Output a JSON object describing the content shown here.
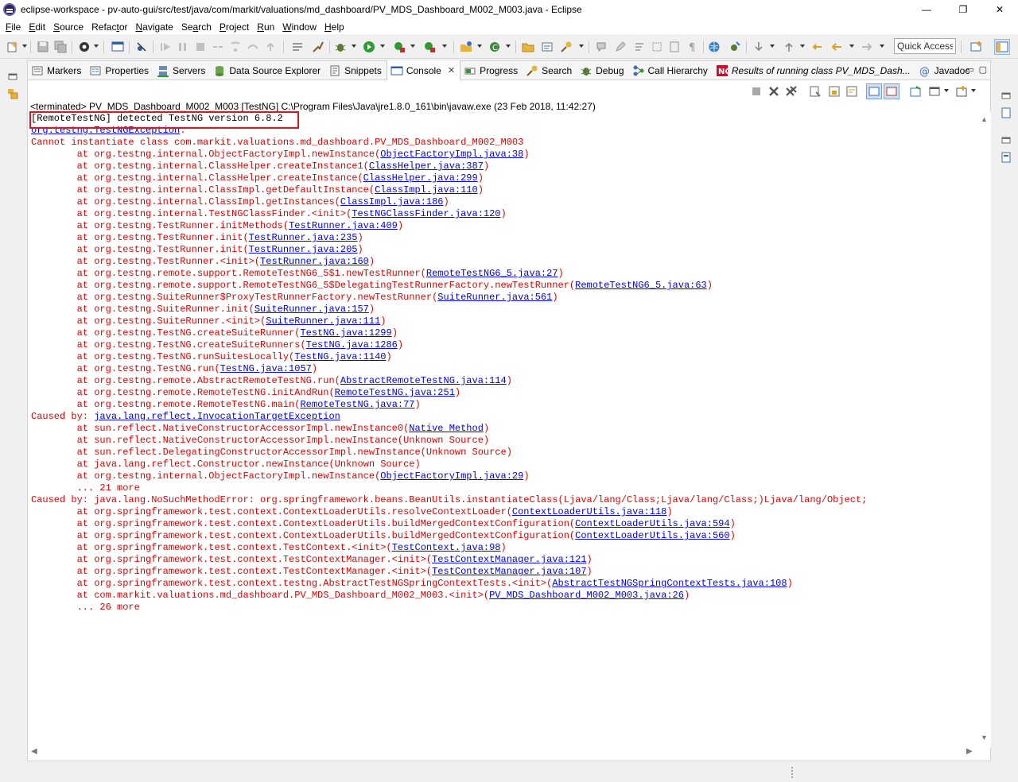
{
  "window": {
    "title": "eclipse-workspace - pv-auto-gui/src/test/java/com/markit/valuations/md_dashboard/PV_MDS_Dashboard_M002_M003.java - Eclipse",
    "minimize": "—",
    "maximize": "❐",
    "close": "✕"
  },
  "menu": [
    {
      "m": "F",
      "rest": "ile"
    },
    {
      "m": "E",
      "rest": "dit"
    },
    {
      "m": "S",
      "rest": "ource"
    },
    {
      "m": "",
      "pre": "Refac",
      "m2": "t",
      "rest": "or"
    },
    {
      "m": "N",
      "rest": "avigate"
    },
    {
      "m": "",
      "pre": "Se",
      "m2": "a",
      "rest": "rch"
    },
    {
      "m": "P",
      "rest": "roject"
    },
    {
      "m": "R",
      "rest": "un"
    },
    {
      "m": "W",
      "rest": "indow"
    },
    {
      "m": "H",
      "rest": "elp"
    }
  ],
  "quick_access": "Quick Access",
  "tabs": [
    {
      "label": "Markers",
      "icon": "markers-icon"
    },
    {
      "label": "Properties",
      "icon": "properties-icon"
    },
    {
      "label": "Servers",
      "icon": "servers-icon"
    },
    {
      "label": "Data Source Explorer",
      "icon": "data-source-icon"
    },
    {
      "label": "Snippets",
      "icon": "snippets-icon"
    },
    {
      "label": "Console",
      "icon": "console-icon",
      "active": true,
      "close": "✕"
    },
    {
      "label": "Progress",
      "icon": "progress-icon"
    },
    {
      "label": "Search",
      "icon": "search-icon"
    },
    {
      "label": "Debug",
      "icon": "debug-icon"
    },
    {
      "label": "Call Hierarchy",
      "icon": "call-hierarchy-icon"
    },
    {
      "label": "Results of running class PV_MDS_Dash...",
      "icon": "testng-icon",
      "italic": true
    },
    {
      "label": "Javadoc",
      "icon": "javadoc-icon"
    }
  ],
  "view_controls": {
    "minimize": "▭",
    "maximize": "▢"
  },
  "console": {
    "header": "<terminated> PV_MDS_Dashboard_M002_M003 [TestNG] C:\\Program Files\\Java\\jre1.8.0_161\\bin\\javaw.exe (23 Feb 2018, 11:42:27)",
    "lines": [
      {
        "type": "info",
        "parts": [
          {
            "t": "[RemoteTestNG] detected TestNG version 6.8.2"
          }
        ]
      },
      {
        "type": "link-only",
        "parts": [
          {
            "t": "org.testng.TestNGException",
            "link": true
          },
          {
            "t": ":"
          }
        ]
      },
      {
        "parts": [
          {
            "t": "Cannot instantiate class com.markit.valuations.md_dashboard.PV_MDS_Dashboard_M002_M003"
          }
        ]
      },
      {
        "parts": [
          {
            "t": "\tat org.testng.internal.ObjectFactoryImpl.newInstance("
          },
          {
            "t": "ObjectFactoryImpl.java:38",
            "link": true
          },
          {
            "t": ")"
          }
        ]
      },
      {
        "parts": [
          {
            "t": "\tat org.testng.internal.ClassHelper.createInstance1("
          },
          {
            "t": "ClassHelper.java:387",
            "link": true
          },
          {
            "t": ")"
          }
        ]
      },
      {
        "parts": [
          {
            "t": "\tat org.testng.internal.ClassHelper.createInstance("
          },
          {
            "t": "ClassHelper.java:299",
            "link": true
          },
          {
            "t": ")"
          }
        ]
      },
      {
        "parts": [
          {
            "t": "\tat org.testng.internal.ClassImpl.getDefaultInstance("
          },
          {
            "t": "ClassImpl.java:110",
            "link": true
          },
          {
            "t": ")"
          }
        ]
      },
      {
        "parts": [
          {
            "t": "\tat org.testng.internal.ClassImpl.getInstances("
          },
          {
            "t": "ClassImpl.java:186",
            "link": true
          },
          {
            "t": ")"
          }
        ]
      },
      {
        "parts": [
          {
            "t": "\tat org.testng.internal.TestNGClassFinder.<init>("
          },
          {
            "t": "TestNGClassFinder.java:120",
            "link": true
          },
          {
            "t": ")"
          }
        ]
      },
      {
        "parts": [
          {
            "t": "\tat org.testng.TestRunner.initMethods("
          },
          {
            "t": "TestRunner.java:409",
            "link": true
          },
          {
            "t": ")"
          }
        ]
      },
      {
        "parts": [
          {
            "t": "\tat org.testng.TestRunner.init("
          },
          {
            "t": "TestRunner.java:235",
            "link": true
          },
          {
            "t": ")"
          }
        ]
      },
      {
        "parts": [
          {
            "t": "\tat org.testng.TestRunner.init("
          },
          {
            "t": "TestRunner.java:205",
            "link": true
          },
          {
            "t": ")"
          }
        ]
      },
      {
        "parts": [
          {
            "t": "\tat org.testng.TestRunner.<init>("
          },
          {
            "t": "TestRunner.java:160",
            "link": true
          },
          {
            "t": ")"
          }
        ]
      },
      {
        "parts": [
          {
            "t": "\tat org.testng.remote.support.RemoteTestNG6_5$1.newTestRunner("
          },
          {
            "t": "RemoteTestNG6_5.java:27",
            "link": true
          },
          {
            "t": ")"
          }
        ]
      },
      {
        "parts": [
          {
            "t": "\tat org.testng.remote.support.RemoteTestNG6_5$DelegatingTestRunnerFactory.newTestRunner("
          },
          {
            "t": "RemoteTestNG6_5.java:63",
            "link": true
          },
          {
            "t": ")"
          }
        ]
      },
      {
        "parts": [
          {
            "t": "\tat org.testng.SuiteRunner$ProxyTestRunnerFactory.newTestRunner("
          },
          {
            "t": "SuiteRunner.java:561",
            "link": true
          },
          {
            "t": ")"
          }
        ]
      },
      {
        "parts": [
          {
            "t": "\tat org.testng.SuiteRunner.init("
          },
          {
            "t": "SuiteRunner.java:157",
            "link": true
          },
          {
            "t": ")"
          }
        ]
      },
      {
        "parts": [
          {
            "t": "\tat org.testng.SuiteRunner.<init>("
          },
          {
            "t": "SuiteRunner.java:111",
            "link": true
          },
          {
            "t": ")"
          }
        ]
      },
      {
        "parts": [
          {
            "t": "\tat org.testng.TestNG.createSuiteRunner("
          },
          {
            "t": "TestNG.java:1299",
            "link": true
          },
          {
            "t": ")"
          }
        ]
      },
      {
        "parts": [
          {
            "t": "\tat org.testng.TestNG.createSuiteRunners("
          },
          {
            "t": "TestNG.java:1286",
            "link": true
          },
          {
            "t": ")"
          }
        ]
      },
      {
        "parts": [
          {
            "t": "\tat org.testng.TestNG.runSuitesLocally("
          },
          {
            "t": "TestNG.java:1140",
            "link": true
          },
          {
            "t": ")"
          }
        ]
      },
      {
        "parts": [
          {
            "t": "\tat org.testng.TestNG.run("
          },
          {
            "t": "TestNG.java:1057",
            "link": true
          },
          {
            "t": ")"
          }
        ]
      },
      {
        "parts": [
          {
            "t": "\tat org.testng.remote.AbstractRemoteTestNG.run("
          },
          {
            "t": "AbstractRemoteTestNG.java:114",
            "link": true
          },
          {
            "t": ")"
          }
        ]
      },
      {
        "parts": [
          {
            "t": "\tat org.testng.remote.RemoteTestNG.initAndRun("
          },
          {
            "t": "RemoteTestNG.java:251",
            "link": true
          },
          {
            "t": ")"
          }
        ]
      },
      {
        "parts": [
          {
            "t": "\tat org.testng.remote.RemoteTestNG.main("
          },
          {
            "t": "RemoteTestNG.java:77",
            "link": true
          },
          {
            "t": ")"
          }
        ]
      },
      {
        "parts": [
          {
            "t": "Caused by: "
          },
          {
            "t": "java.lang.reflect.InvocationTargetException",
            "link": true
          }
        ]
      },
      {
        "parts": [
          {
            "t": "\tat sun.reflect.NativeConstructorAccessorImpl.newInstance0("
          },
          {
            "t": "Native Method",
            "link": true
          },
          {
            "t": ")"
          }
        ]
      },
      {
        "parts": [
          {
            "t": "\tat sun.reflect.NativeConstructorAccessorImpl.newInstance(Unknown Source)"
          }
        ]
      },
      {
        "parts": [
          {
            "t": "\tat sun.reflect.DelegatingConstructorAccessorImpl.newInstance(Unknown Source)"
          }
        ]
      },
      {
        "parts": [
          {
            "t": "\tat java.lang.reflect.Constructor.newInstance(Unknown Source)"
          }
        ]
      },
      {
        "parts": [
          {
            "t": "\tat org.testng.internal.ObjectFactoryImpl.newInstance("
          },
          {
            "t": "ObjectFactoryImpl.java:29",
            "link": true
          },
          {
            "t": ")"
          }
        ]
      },
      {
        "parts": [
          {
            "t": "\t... 21 more"
          }
        ]
      },
      {
        "parts": [
          {
            "t": "Caused by: java.lang.NoSuchMethodError: org.springframework.beans.BeanUtils.instantiateClass(Ljava/lang/Class;Ljava/lang/Class;)Ljava/lang/Object;"
          }
        ]
      },
      {
        "parts": [
          {
            "t": "\tat org.springframework.test.context.ContextLoaderUtils.resolveContextLoader("
          },
          {
            "t": "ContextLoaderUtils.java:118",
            "link": true
          },
          {
            "t": ")"
          }
        ]
      },
      {
        "parts": [
          {
            "t": "\tat org.springframework.test.context.ContextLoaderUtils.buildMergedContextConfiguration("
          },
          {
            "t": "ContextLoaderUtils.java:594",
            "link": true
          },
          {
            "t": ")"
          }
        ]
      },
      {
        "parts": [
          {
            "t": "\tat org.springframework.test.context.ContextLoaderUtils.buildMergedContextConfiguration("
          },
          {
            "t": "ContextLoaderUtils.java:560",
            "link": true
          },
          {
            "t": ")"
          }
        ]
      },
      {
        "parts": [
          {
            "t": "\tat org.springframework.test.context.TestContext.<init>("
          },
          {
            "t": "TestContext.java:98",
            "link": true
          },
          {
            "t": ")"
          }
        ]
      },
      {
        "parts": [
          {
            "t": "\tat org.springframework.test.context.TestContextManager.<init>("
          },
          {
            "t": "TestContextManager.java:121",
            "link": true
          },
          {
            "t": ")"
          }
        ]
      },
      {
        "parts": [
          {
            "t": "\tat org.springframework.test.context.TestContextManager.<init>("
          },
          {
            "t": "TestContextManager.java:107",
            "link": true
          },
          {
            "t": ")"
          }
        ]
      },
      {
        "parts": [
          {
            "t": "\tat org.springframework.test.context.testng.AbstractTestNGSpringContextTests.<init>("
          },
          {
            "t": "AbstractTestNGSpringContextTests.java:108",
            "link": true
          },
          {
            "t": ")"
          }
        ]
      },
      {
        "parts": [
          {
            "t": "\tat com.markit.valuations.md_dashboard.PV_MDS_Dashboard_M002_M003.<init>("
          },
          {
            "t": "PV_MDS_Dashboard_M002_M003.java:26",
            "link": true
          },
          {
            "t": ")"
          }
        ]
      },
      {
        "parts": [
          {
            "t": "\t... 26 more"
          }
        ]
      }
    ]
  },
  "colors": {
    "error_text": "#e40000",
    "link": "#0000ee",
    "highlight": "#e0141e"
  },
  "scroll": {
    "up": "▲",
    "down": "▼",
    "left": "◀",
    "right": "▶"
  }
}
